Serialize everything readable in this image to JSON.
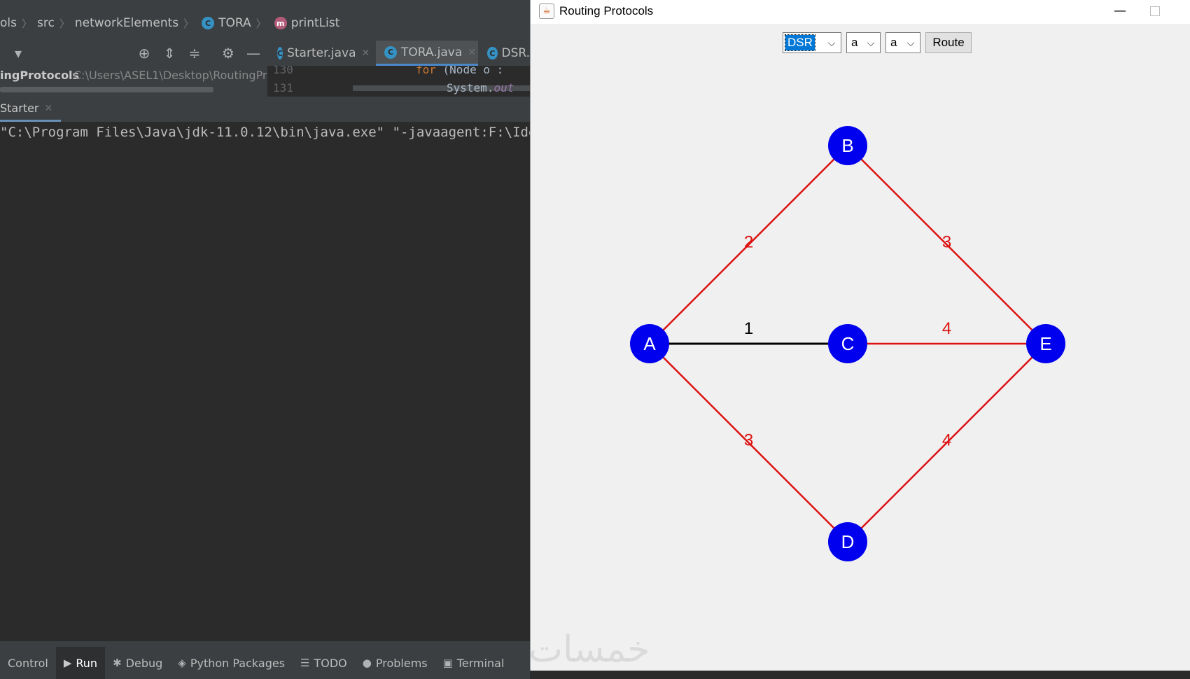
{
  "ide": {
    "breadcrumb": [
      {
        "label": "ols",
        "icon": ""
      },
      {
        "label": "src",
        "icon": ""
      },
      {
        "label": "networkElements",
        "icon": ""
      },
      {
        "label": "TORA",
        "icon": "class-icon"
      },
      {
        "label": "printList",
        "icon": "method-icon"
      }
    ],
    "tabs": [
      {
        "label": "Starter.java",
        "active": false
      },
      {
        "label": "TORA.java",
        "active": true
      },
      {
        "label": "DSR.",
        "active": false
      }
    ],
    "project": {
      "name": "ingProtocols",
      "path": "C:\\Users\\ASEL1\\Desktop\\RoutingPro"
    },
    "editor": {
      "line1_no": "130",
      "line1_keyword": "for",
      "line1_rest": " (Node o :",
      "line2_no": "131",
      "line2_text": "System.",
      "line2_field": "out"
    },
    "run_tab": "Starter",
    "console_text": "\"C:\\Program Files\\Java\\jdk-11.0.12\\bin\\java.exe\" \"-javaagent:F:\\Ide",
    "bottom_bar": [
      {
        "label": "Control",
        "icon": "",
        "active": false
      },
      {
        "label": "Run",
        "icon": "run-icon",
        "active": true
      },
      {
        "label": "Debug",
        "icon": "debug-icon",
        "active": false
      },
      {
        "label": "Python Packages",
        "icon": "packages-icon",
        "active": false
      },
      {
        "label": "TODO",
        "icon": "todo-icon",
        "active": false
      },
      {
        "label": "Problems",
        "icon": "problems-icon",
        "active": false
      },
      {
        "label": "Terminal",
        "icon": "terminal-icon",
        "active": false
      }
    ]
  },
  "window": {
    "title": "Routing Protocols",
    "protocol_select": "DSR",
    "source_select": "a",
    "dest_select": "a",
    "route_button": "Route"
  },
  "graph": {
    "colors": {
      "node": "#0000ee",
      "node_text": "#ffffff",
      "route_edge": "#dd1111",
      "plain_edge": "#000000"
    },
    "nodes": [
      {
        "id": "A"
      },
      {
        "id": "B"
      },
      {
        "id": "C"
      },
      {
        "id": "D"
      },
      {
        "id": "E"
      }
    ],
    "edges": [
      {
        "from": "A",
        "to": "B",
        "weight": "2",
        "highlighted": true
      },
      {
        "from": "B",
        "to": "E",
        "weight": "3",
        "highlighted": true
      },
      {
        "from": "A",
        "to": "C",
        "weight": "1",
        "highlighted": false
      },
      {
        "from": "C",
        "to": "E",
        "weight": "4",
        "highlighted": true
      },
      {
        "from": "A",
        "to": "D",
        "weight": "3",
        "highlighted": true
      },
      {
        "from": "D",
        "to": "E",
        "weight": "4",
        "highlighted": true
      }
    ]
  },
  "watermark": "خمسات"
}
